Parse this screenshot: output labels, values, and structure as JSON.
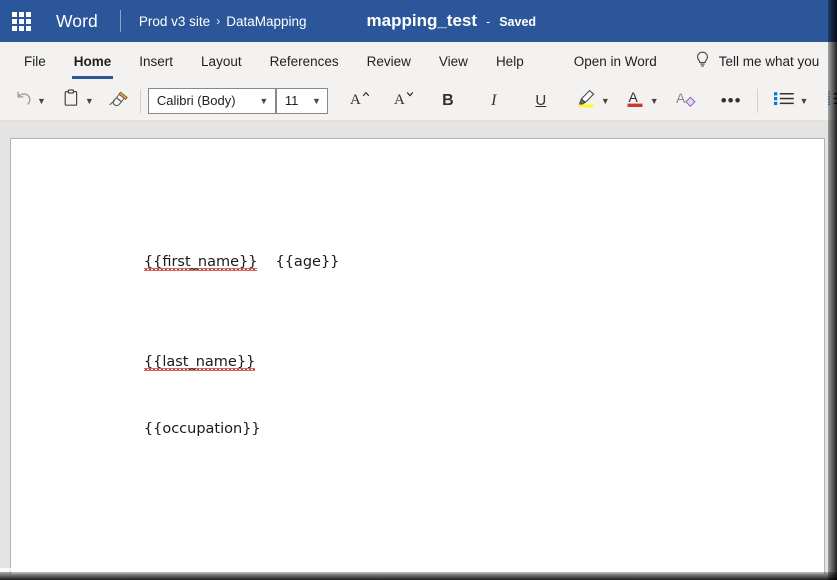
{
  "titlebar": {
    "app_launcher_icon": "waffle-grid-icon",
    "app_name": "Word",
    "breadcrumb": {
      "site": "Prod v3 site",
      "separator": "›",
      "folder": "DataMapping"
    },
    "document_title": "mapping_test",
    "title_dash": "-",
    "save_status": "Saved",
    "accent_color": "#2b579a"
  },
  "ribbon": {
    "tabs": [
      {
        "label": "File",
        "active": false
      },
      {
        "label": "Home",
        "active": true
      },
      {
        "label": "Insert",
        "active": false
      },
      {
        "label": "Layout",
        "active": false
      },
      {
        "label": "References",
        "active": false
      },
      {
        "label": "Review",
        "active": false
      },
      {
        "label": "View",
        "active": false
      },
      {
        "label": "Help",
        "active": false
      },
      {
        "label": "Open in Word",
        "active": false
      }
    ],
    "active_tab_underline_color": "#2b579a",
    "tell_me": {
      "icon": "lightbulb-icon",
      "label": "Tell me what you"
    }
  },
  "toolbar": {
    "undo": {
      "icon": "undo-icon",
      "label": "Undo"
    },
    "paste": {
      "icon": "clipboard-paste-icon",
      "label": "Paste"
    },
    "format_painter": {
      "icon": "format-painter-icon",
      "label": "Format Painter"
    },
    "font_name": {
      "value": "Calibri (Body)",
      "placeholder": "Font"
    },
    "font_size": {
      "value": "11",
      "placeholder": "Size"
    },
    "grow_font": {
      "icon": "grow-font-icon",
      "label": "A"
    },
    "shrink_font": {
      "icon": "shrink-font-icon",
      "label": "A"
    },
    "bold": {
      "icon": "bold-icon",
      "label": "B"
    },
    "italic": {
      "icon": "italic-icon",
      "label": "I"
    },
    "underline": {
      "icon": "underline-icon",
      "label": "U"
    },
    "highlight": {
      "icon": "text-highlight-icon",
      "color": "#ffff00"
    },
    "font_color": {
      "icon": "font-color-icon",
      "color": "#d13438",
      "label": "A"
    },
    "clear_formatting": {
      "icon": "clear-formatting-icon",
      "label": "A"
    },
    "more_commands": {
      "icon": "ellipsis-icon",
      "label": "•••"
    },
    "bullet_list": {
      "icon": "bullet-list-icon"
    },
    "numbered_list": {
      "icon": "numbered-list-icon"
    },
    "indent": {
      "icon": "indent-icon"
    }
  },
  "document": {
    "paragraphs": [
      {
        "text": "{{first_name}}",
        "misspelled": true
      },
      {
        "text": "{{age}}",
        "misspelled": false
      },
      {
        "text": "{{last_name}}",
        "misspelled": true
      },
      {
        "text": "{{occupation}}",
        "misspelled": false
      }
    ],
    "line1_left": "{{first_name}}",
    "line1_right": "{{age}}",
    "line2": "{{last_name}}",
    "line3": "{{occupation}}",
    "page_background": "#ffffff",
    "canvas_background": "#e6e4e2"
  }
}
